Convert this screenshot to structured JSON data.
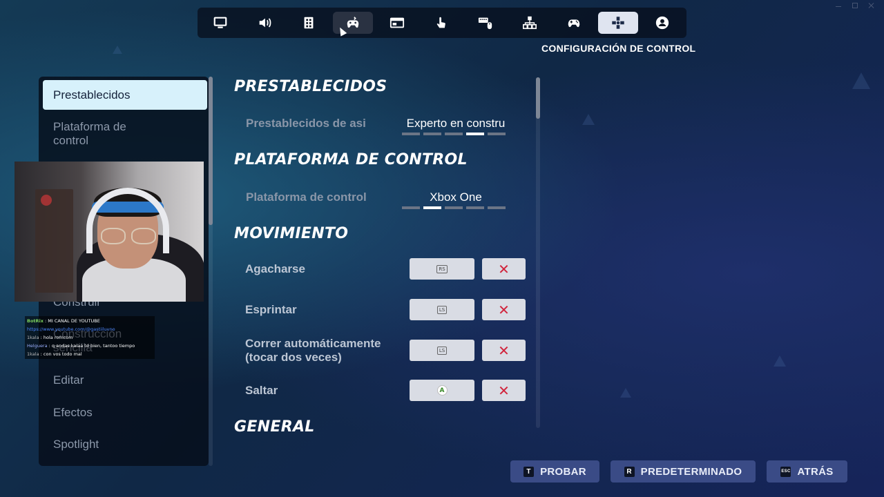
{
  "window": {
    "controls": [
      "minimize",
      "maximize",
      "close"
    ]
  },
  "tabs": [
    {
      "icon": "monitor-icon",
      "state": "normal"
    },
    {
      "icon": "volume-icon",
      "state": "normal"
    },
    {
      "icon": "game-settings-icon",
      "state": "normal"
    },
    {
      "icon": "accessibility-controller-icon",
      "state": "hover"
    },
    {
      "icon": "hud-icon",
      "state": "normal"
    },
    {
      "icon": "touch-icon",
      "state": "normal"
    },
    {
      "icon": "keyboard-mouse-icon",
      "state": "normal"
    },
    {
      "icon": "network-icon",
      "state": "normal"
    },
    {
      "icon": "controller-icon",
      "state": "normal"
    },
    {
      "icon": "controller-settings-icon",
      "state": "active"
    },
    {
      "icon": "account-icon",
      "state": "normal"
    }
  ],
  "page_heading": "CONFIGURACIÓN DE CONTROL",
  "sidebar": {
    "items": [
      {
        "label": "Prestablecidos",
        "active": true
      },
      {
        "label": "Plataforma de control"
      },
      {
        "label": "Construir"
      },
      {
        "label": "Construcción"
      },
      {
        "label": "sencilla"
      },
      {
        "label": "Editar"
      },
      {
        "label": "Efectos"
      },
      {
        "label": "Spotlight"
      }
    ]
  },
  "chat": {
    "lines": [
      {
        "user": "BotRix",
        "text": ": MI CANAL DE YOUTUBE"
      },
      {
        "user": "",
        "text": "https://www.youtube.com/@gastiiluvno"
      },
      {
        "user": "1kala",
        "text": ": hola romcom"
      },
      {
        "user": "Helguera",
        "text": ": q andas kalaa td bien, tantoo tiempo"
      },
      {
        "user": "1kala",
        "text": ": con vos todo mal"
      }
    ]
  },
  "sections": {
    "presets": {
      "title": "PRESTABLECIDOS",
      "option_label": "Prestablecidos de asi",
      "option_value": "Experto en constru",
      "selected_index": 3,
      "option_count": 5
    },
    "platform": {
      "title": "PLATAFORMA DE CONTROL",
      "option_label": "Plataforma de control",
      "option_value": "Xbox One",
      "selected_index": 1,
      "option_count": 5
    },
    "movement": {
      "title": "MOVIMIENTO",
      "bindings": [
        {
          "label": "Agacharse",
          "key": "RS"
        },
        {
          "label": "Esprintar",
          "key": "LS"
        },
        {
          "label": "Correr automáticamente\n(tocar dos veces)",
          "key": "LS"
        },
        {
          "label": "Saltar",
          "key": "A"
        }
      ],
      "clear_symbol": "✕"
    },
    "general": {
      "title": "GENERAL"
    }
  },
  "footer": {
    "probar": {
      "key": "T",
      "label": "PROBAR"
    },
    "predeterminado": {
      "key": "R",
      "label": "PREDETERMINADO"
    },
    "atras": {
      "key": "ESC",
      "label": "ATRÁS"
    }
  },
  "colors": {
    "sidebar_active_bg": "#d7f1fb",
    "footer_button_bg": "#3a4b86",
    "clear_x": "#d1243c",
    "tab_active_bg": "#dfe4f0"
  }
}
